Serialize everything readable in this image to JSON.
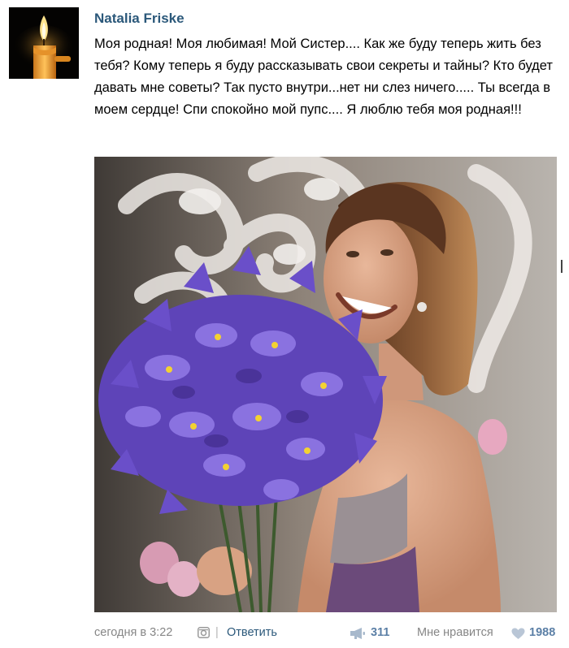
{
  "post": {
    "author": "Natalia Friske",
    "text": "Моя родная! Моя любимая! Мой Систер.... Как же буду теперь жить без тебя? Кому теперь я буду рассказывать свои секреты и тайны? Кто будет давать мне советы? Так пусто внутри...нет ни слез ничего..... Ты всегда в моем сердце! Спи спокойно мой пупс.... Я люблю тебя моя родная!!!",
    "avatar_icon": "candle-icon",
    "photo_icon": "photo-woman-with-irises"
  },
  "footer": {
    "time": "сегодня в 3:22",
    "separator": "|",
    "reply_label": "Ответить",
    "share_count": "311",
    "like_label": "Мне нравится",
    "like_count": "1988"
  },
  "colors": {
    "link": "#2b587a",
    "count": "#5b7fa6",
    "muted": "#868686",
    "iris": "#6a4fc9"
  }
}
